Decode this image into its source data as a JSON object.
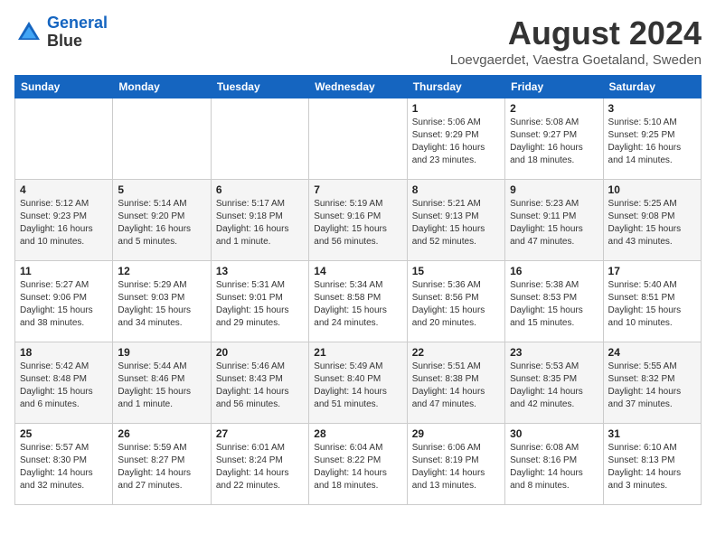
{
  "header": {
    "logo_line1": "General",
    "logo_line2": "Blue",
    "month_title": "August 2024",
    "location": "Loevgaerdet, Vaestra Goetaland, Sweden"
  },
  "days_of_week": [
    "Sunday",
    "Monday",
    "Tuesday",
    "Wednesday",
    "Thursday",
    "Friday",
    "Saturday"
  ],
  "weeks": [
    [
      {
        "day": "",
        "info": ""
      },
      {
        "day": "",
        "info": ""
      },
      {
        "day": "",
        "info": ""
      },
      {
        "day": "",
        "info": ""
      },
      {
        "day": "1",
        "info": "Sunrise: 5:06 AM\nSunset: 9:29 PM\nDaylight: 16 hours\nand 23 minutes."
      },
      {
        "day": "2",
        "info": "Sunrise: 5:08 AM\nSunset: 9:27 PM\nDaylight: 16 hours\nand 18 minutes."
      },
      {
        "day": "3",
        "info": "Sunrise: 5:10 AM\nSunset: 9:25 PM\nDaylight: 16 hours\nand 14 minutes."
      }
    ],
    [
      {
        "day": "4",
        "info": "Sunrise: 5:12 AM\nSunset: 9:23 PM\nDaylight: 16 hours\nand 10 minutes."
      },
      {
        "day": "5",
        "info": "Sunrise: 5:14 AM\nSunset: 9:20 PM\nDaylight: 16 hours\nand 5 minutes."
      },
      {
        "day": "6",
        "info": "Sunrise: 5:17 AM\nSunset: 9:18 PM\nDaylight: 16 hours\nand 1 minute."
      },
      {
        "day": "7",
        "info": "Sunrise: 5:19 AM\nSunset: 9:16 PM\nDaylight: 15 hours\nand 56 minutes."
      },
      {
        "day": "8",
        "info": "Sunrise: 5:21 AM\nSunset: 9:13 PM\nDaylight: 15 hours\nand 52 minutes."
      },
      {
        "day": "9",
        "info": "Sunrise: 5:23 AM\nSunset: 9:11 PM\nDaylight: 15 hours\nand 47 minutes."
      },
      {
        "day": "10",
        "info": "Sunrise: 5:25 AM\nSunset: 9:08 PM\nDaylight: 15 hours\nand 43 minutes."
      }
    ],
    [
      {
        "day": "11",
        "info": "Sunrise: 5:27 AM\nSunset: 9:06 PM\nDaylight: 15 hours\nand 38 minutes."
      },
      {
        "day": "12",
        "info": "Sunrise: 5:29 AM\nSunset: 9:03 PM\nDaylight: 15 hours\nand 34 minutes."
      },
      {
        "day": "13",
        "info": "Sunrise: 5:31 AM\nSunset: 9:01 PM\nDaylight: 15 hours\nand 29 minutes."
      },
      {
        "day": "14",
        "info": "Sunrise: 5:34 AM\nSunset: 8:58 PM\nDaylight: 15 hours\nand 24 minutes."
      },
      {
        "day": "15",
        "info": "Sunrise: 5:36 AM\nSunset: 8:56 PM\nDaylight: 15 hours\nand 20 minutes."
      },
      {
        "day": "16",
        "info": "Sunrise: 5:38 AM\nSunset: 8:53 PM\nDaylight: 15 hours\nand 15 minutes."
      },
      {
        "day": "17",
        "info": "Sunrise: 5:40 AM\nSunset: 8:51 PM\nDaylight: 15 hours\nand 10 minutes."
      }
    ],
    [
      {
        "day": "18",
        "info": "Sunrise: 5:42 AM\nSunset: 8:48 PM\nDaylight: 15 hours\nand 6 minutes."
      },
      {
        "day": "19",
        "info": "Sunrise: 5:44 AM\nSunset: 8:46 PM\nDaylight: 15 hours\nand 1 minute."
      },
      {
        "day": "20",
        "info": "Sunrise: 5:46 AM\nSunset: 8:43 PM\nDaylight: 14 hours\nand 56 minutes."
      },
      {
        "day": "21",
        "info": "Sunrise: 5:49 AM\nSunset: 8:40 PM\nDaylight: 14 hours\nand 51 minutes."
      },
      {
        "day": "22",
        "info": "Sunrise: 5:51 AM\nSunset: 8:38 PM\nDaylight: 14 hours\nand 47 minutes."
      },
      {
        "day": "23",
        "info": "Sunrise: 5:53 AM\nSunset: 8:35 PM\nDaylight: 14 hours\nand 42 minutes."
      },
      {
        "day": "24",
        "info": "Sunrise: 5:55 AM\nSunset: 8:32 PM\nDaylight: 14 hours\nand 37 minutes."
      }
    ],
    [
      {
        "day": "25",
        "info": "Sunrise: 5:57 AM\nSunset: 8:30 PM\nDaylight: 14 hours\nand 32 minutes."
      },
      {
        "day": "26",
        "info": "Sunrise: 5:59 AM\nSunset: 8:27 PM\nDaylight: 14 hours\nand 27 minutes."
      },
      {
        "day": "27",
        "info": "Sunrise: 6:01 AM\nSunset: 8:24 PM\nDaylight: 14 hours\nand 22 minutes."
      },
      {
        "day": "28",
        "info": "Sunrise: 6:04 AM\nSunset: 8:22 PM\nDaylight: 14 hours\nand 18 minutes."
      },
      {
        "day": "29",
        "info": "Sunrise: 6:06 AM\nSunset: 8:19 PM\nDaylight: 14 hours\nand 13 minutes."
      },
      {
        "day": "30",
        "info": "Sunrise: 6:08 AM\nSunset: 8:16 PM\nDaylight: 14 hours\nand 8 minutes."
      },
      {
        "day": "31",
        "info": "Sunrise: 6:10 AM\nSunset: 8:13 PM\nDaylight: 14 hours\nand 3 minutes."
      }
    ]
  ]
}
